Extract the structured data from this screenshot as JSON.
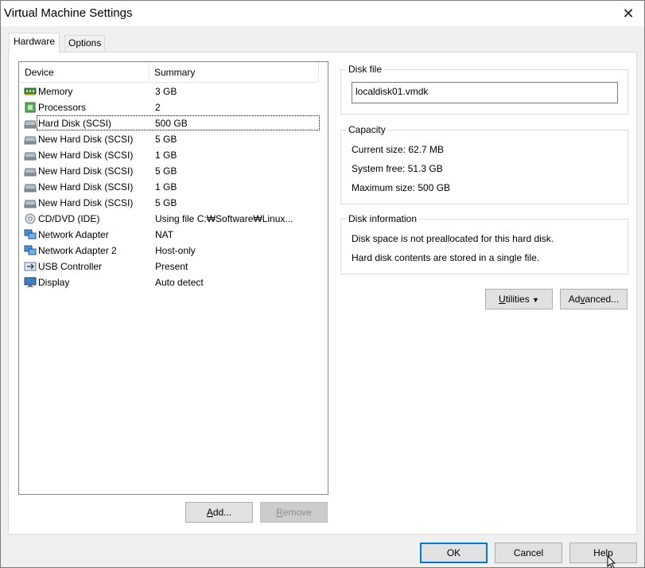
{
  "window": {
    "title": "Virtual Machine Settings",
    "close_glyph": "✕"
  },
  "tabs": [
    {
      "label": "Hardware",
      "active": true
    },
    {
      "label": "Options",
      "active": false
    }
  ],
  "device_list": {
    "columns": {
      "device": "Device",
      "summary": "Summary"
    },
    "rows": [
      {
        "icon": "memory-icon",
        "device": "Memory",
        "summary": "3 GB"
      },
      {
        "icon": "processor-icon",
        "device": "Processors",
        "summary": "2"
      },
      {
        "icon": "hard-disk-icon",
        "device": "Hard Disk (SCSI)",
        "summary": "500 GB",
        "selected": true
      },
      {
        "icon": "hard-disk-icon",
        "device": "New Hard Disk (SCSI)",
        "summary": "5 GB"
      },
      {
        "icon": "hard-disk-icon",
        "device": "New Hard Disk (SCSI)",
        "summary": "1 GB"
      },
      {
        "icon": "hard-disk-icon",
        "device": "New Hard Disk (SCSI)",
        "summary": "5 GB"
      },
      {
        "icon": "hard-disk-icon",
        "device": "New Hard Disk (SCSI)",
        "summary": "1 GB"
      },
      {
        "icon": "hard-disk-icon",
        "device": "New Hard Disk (SCSI)",
        "summary": "5 GB"
      },
      {
        "icon": "cd-dvd-icon",
        "device": "CD/DVD (IDE)",
        "summary": "Using file C:₩Software₩Linux..."
      },
      {
        "icon": "network-adapter-icon",
        "device": "Network Adapter",
        "summary": "NAT"
      },
      {
        "icon": "network-adapter-icon",
        "device": "Network Adapter 2",
        "summary": "Host-only"
      },
      {
        "icon": "usb-icon",
        "device": "USB Controller",
        "summary": "Present"
      },
      {
        "icon": "display-icon",
        "device": "Display",
        "summary": "Auto detect"
      }
    ]
  },
  "list_buttons": {
    "add": "Add...",
    "add_mnemonic": "A",
    "add_rest": "dd...",
    "remove_mnemonic": "R",
    "remove_rest": "emove"
  },
  "disk_file": {
    "title": "Disk file",
    "value": "localdisk01.vmdk"
  },
  "capacity": {
    "title": "Capacity",
    "current_size": "Current size: 62.7 MB",
    "system_free": "System free: 51.3 GB",
    "maximum_size": "Maximum size: 500 GB"
  },
  "disk_information": {
    "title": "Disk information",
    "line1": "Disk space is not preallocated for this hard disk.",
    "line2": "Hard disk contents are stored in a single file."
  },
  "disk_buttons": {
    "utilities_mnemonic": "U",
    "utilities_rest": "tilities",
    "advanced_pre": "Ad",
    "advanced_mnemonic": "v",
    "advanced_rest": "anced..."
  },
  "footer": {
    "ok": "OK",
    "cancel": "Cancel",
    "help": "Help"
  },
  "colors": {
    "accent": "#0078d7",
    "window_bg": "#f0f0f0",
    "panel_bg": "#ffffff"
  }
}
